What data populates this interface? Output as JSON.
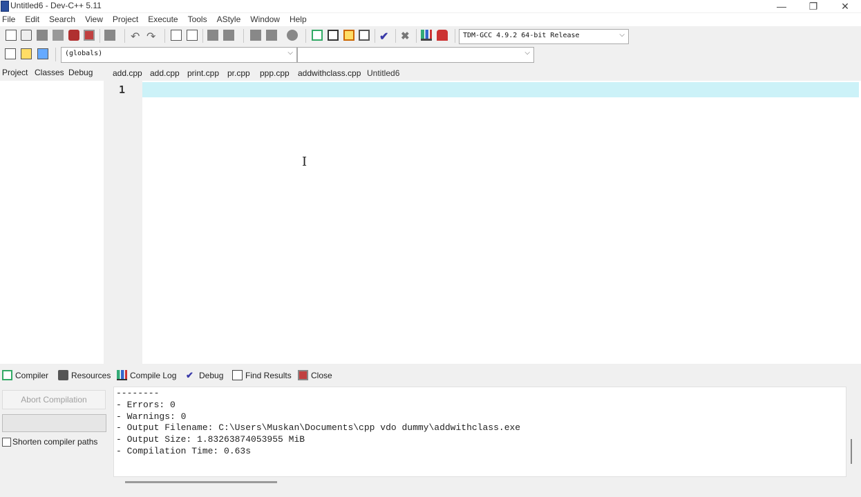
{
  "window": {
    "title": "Untitled6 - Dev-C++ 5.11",
    "minimize_glyph": "—",
    "maximize_glyph": "❐",
    "close_glyph": "✕"
  },
  "menu": [
    "File",
    "Edit",
    "Search",
    "View",
    "Project",
    "Execute",
    "Tools",
    "AStyle",
    "Window",
    "Help"
  ],
  "toolbar": {
    "compiler_select": "TDM-GCC 4.9.2 64-bit Release",
    "scope_select": "(globals)",
    "function_select": ""
  },
  "left_tabs": [
    "Project",
    "Classes",
    "Debug"
  ],
  "file_tabs": [
    "add.cpp",
    "add.cpp",
    "print.cpp",
    "pr.cpp",
    "ppp.cpp",
    "addwithclass.cpp",
    "Untitled6"
  ],
  "active_file_tab": "Untitled6",
  "editor": {
    "line_numbers": [
      "1"
    ],
    "lines": [
      ""
    ]
  },
  "bottom_tabs": [
    "Compiler",
    "Resources",
    "Compile Log",
    "Debug",
    "Find Results",
    "Close"
  ],
  "compile_panel": {
    "abort_button": "Abort Compilation",
    "shorten_paths_label": "Shorten compiler paths",
    "shorten_paths_checked": false
  },
  "compile_log": [
    "--------",
    "- Errors: 0",
    "- Warnings: 0",
    "- Output Filename: C:\\Users\\Muskan\\Documents\\cpp vdo dummy\\addwithclass.exe",
    "- Output Size: 1.83263874053955 MiB",
    "- Compilation Time: 0.63s"
  ],
  "colors": {
    "current_line": "#ccf2f8",
    "gutter": "#f0f0f0",
    "app_icon": "#2b4f9e"
  }
}
